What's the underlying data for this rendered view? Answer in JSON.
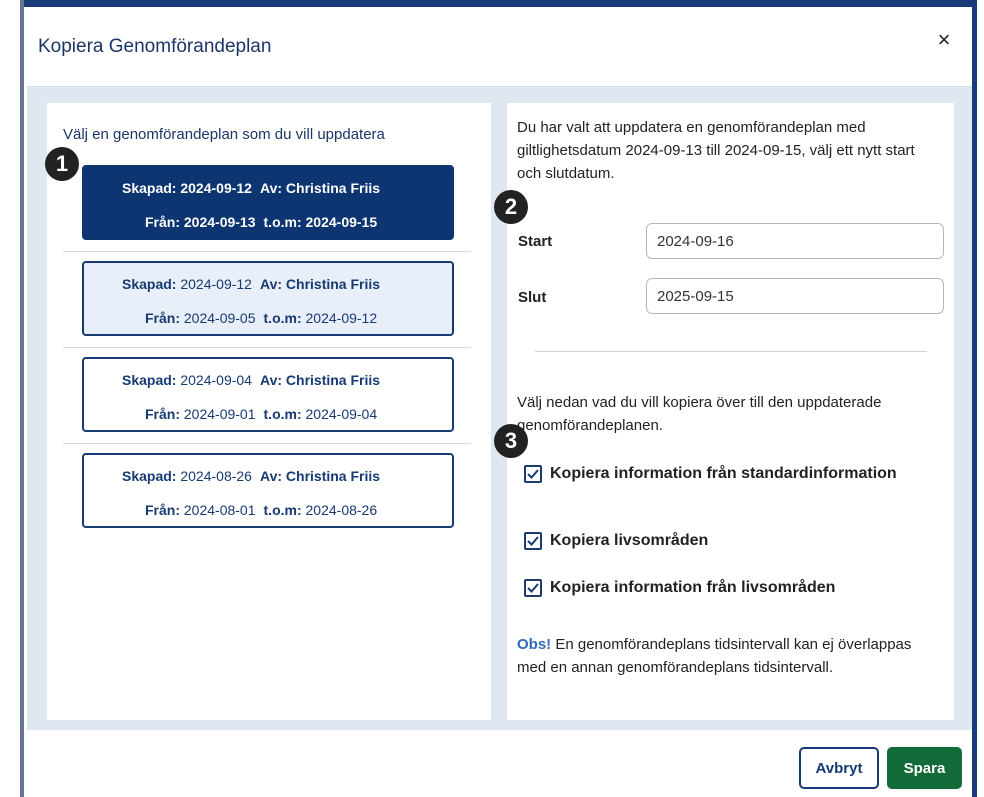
{
  "dialog": {
    "title": "Kopiera Genomförandeplan",
    "close_symbol": "×"
  },
  "left": {
    "heading": "Välj en genomförandeplan som du vill uppdatera",
    "plans": [
      {
        "created_label": "Skapad:",
        "created": "2024-09-12",
        "by_label": "Av:",
        "by": "Christina Friis",
        "from_label": "Från:",
        "from": "2024-09-13",
        "to_label": "t.o.m:",
        "to": "2024-09-15",
        "selected": true
      },
      {
        "created_label": "Skapad:",
        "created": "2024-09-12",
        "by_label": "Av:",
        "by": "Christina Friis",
        "from_label": "Från:",
        "from": "2024-09-05",
        "to_label": "t.o.m:",
        "to": "2024-09-12",
        "selected": false
      },
      {
        "created_label": "Skapad:",
        "created": "2024-09-04",
        "by_label": "Av:",
        "by": "Christina Friis",
        "from_label": "Från:",
        "from": "2024-09-01",
        "to_label": "t.o.m:",
        "to": "2024-09-04",
        "selected": false
      },
      {
        "created_label": "Skapad:",
        "created": "2024-08-26",
        "by_label": "Av:",
        "by": "Christina Friis",
        "from_label": "Från:",
        "from": "2024-08-01",
        "to_label": "t.o.m:",
        "to": "2024-08-26",
        "selected": false
      }
    ]
  },
  "right": {
    "info": "Du har valt att uppdatera en genomförandeplan med giltlighetsdatum 2024-09-13 till 2024-09-15, välj ett nytt start och slutdatum.",
    "start_label": "Start",
    "start_value": "2024-09-16",
    "end_label": "Slut",
    "end_value": "2025-09-15",
    "copy_prompt": "Välj nedan vad du vill kopiera över till den uppdaterade genomförandeplanen.",
    "checkboxes": [
      {
        "label": "Kopiera information från standardinformation",
        "checked": true
      },
      {
        "label": "Kopiera livsområden",
        "checked": true
      },
      {
        "label": "Kopiera information från livsområden",
        "checked": true
      }
    ],
    "note_obs": "Obs!",
    "note_text": " En genomförandeplans tidsintervall kan ej överlappas med en annan genomförandeplans tidsintervall."
  },
  "badges": [
    "1",
    "2",
    "3"
  ],
  "footer": {
    "cancel_label": "Avbryt",
    "save_label": "Spara"
  },
  "colors": {
    "primary": "#0d3571",
    "accent_green": "#146b3a",
    "dialog_bg": "#dfe7f0",
    "selected_soft": "#e8eff8",
    "obs_blue": "#2e6bbd"
  }
}
